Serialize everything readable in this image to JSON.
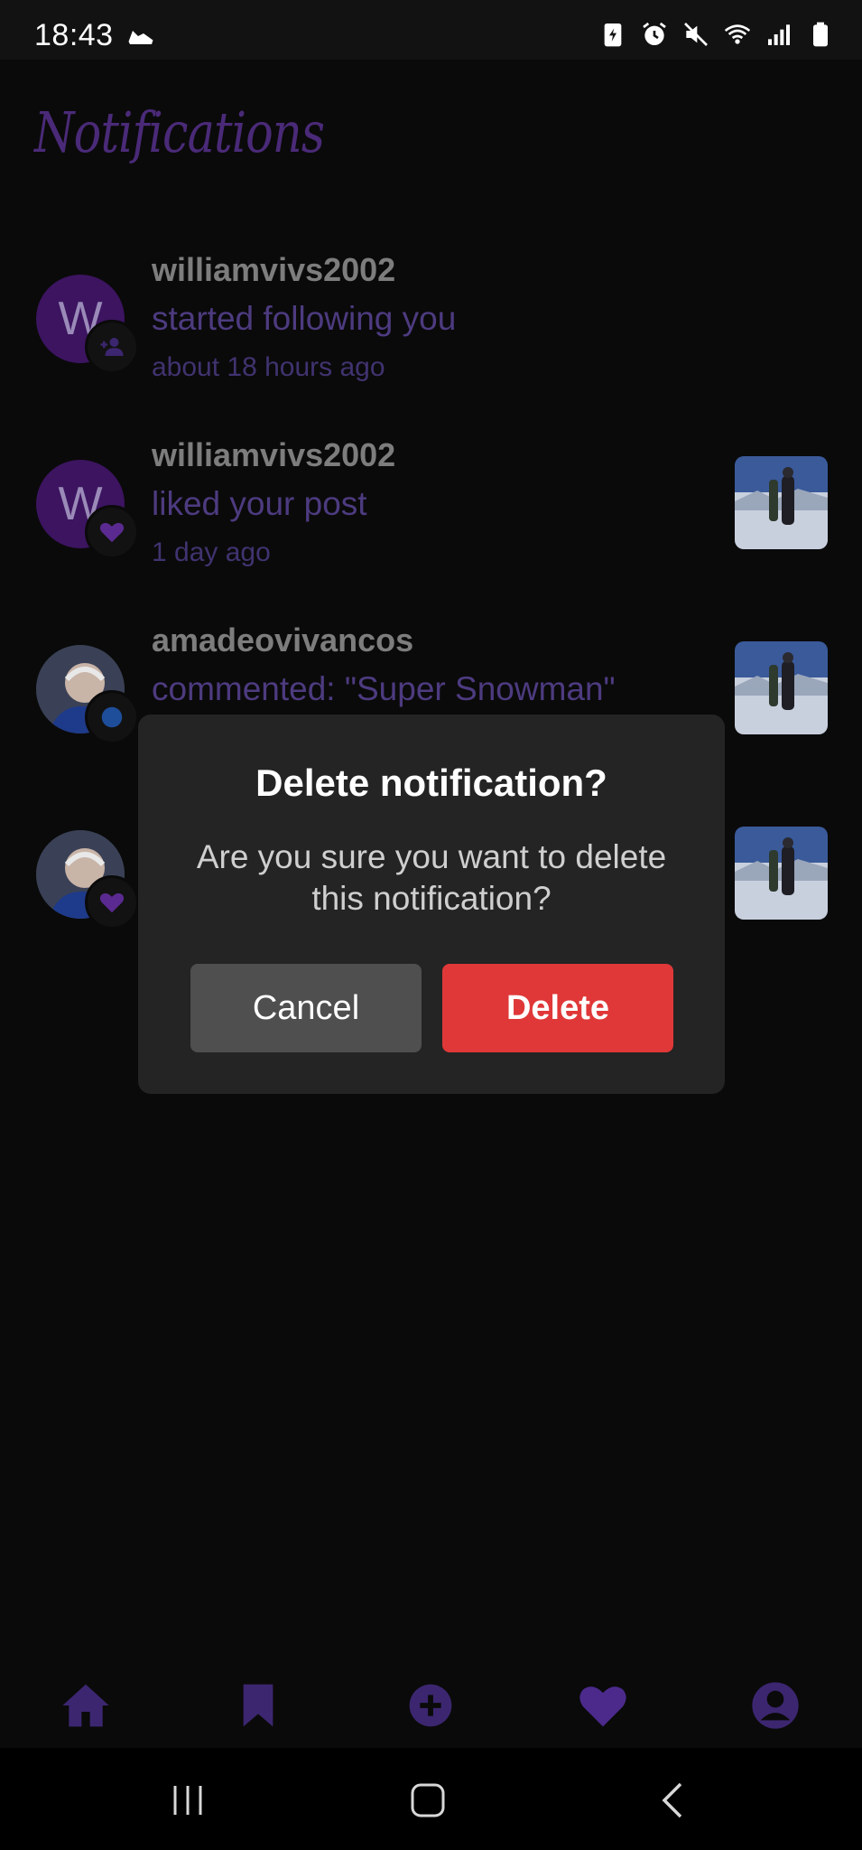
{
  "status_bar": {
    "time": "18:43"
  },
  "page": {
    "title": "Notifications"
  },
  "notifications": [
    {
      "user": "williamvivs2002",
      "action": "started following you",
      "time": "about 18 hours ago",
      "avatar_letter": "W"
    },
    {
      "user": "williamvivs2002",
      "action": "liked your post",
      "time": "1 day ago",
      "avatar_letter": "W"
    },
    {
      "user": "amadeovivancos",
      "action": "commented: \"Super Snowman\""
    }
  ],
  "dialog": {
    "title": "Delete notification?",
    "message": "Are you sure you want to delete this notification?",
    "cancel_label": "Cancel",
    "delete_label": "Delete"
  },
  "colors": {
    "accent": "#4a2a78",
    "delete": "#e03838",
    "nav_icon": "#3c2670"
  }
}
